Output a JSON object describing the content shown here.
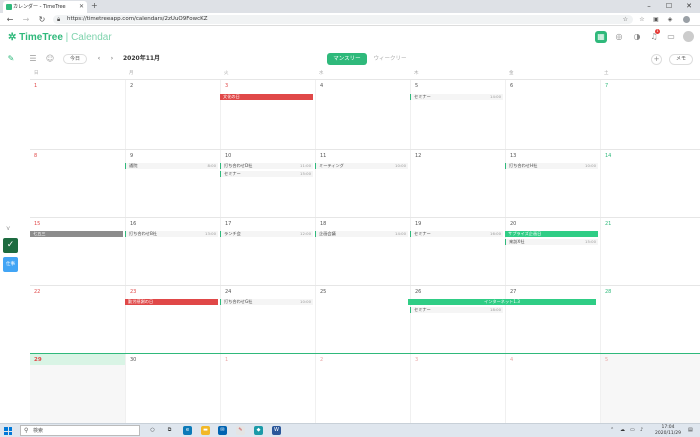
{
  "browser": {
    "tab_title": "カレンダー - TimeTree",
    "new_tab": "+",
    "url": "https://timetreeapp.com/calendars/2zUuO9FowcKZ",
    "win_min": "–",
    "win_max": "☐",
    "win_close": "✕"
  },
  "app": {
    "logo": "TimeTree",
    "logo_sub": "Calendar",
    "badge_count": "1"
  },
  "toolbar": {
    "today": "今日",
    "prev": "‹",
    "next": "›",
    "month": "2020年11月",
    "monthly": "マンスリー",
    "weekly": "ウィークリー",
    "add": "+",
    "memo": "メモ"
  },
  "rail": {
    "tag": "仕事"
  },
  "calendar": {
    "weekdays": [
      "日",
      "月",
      "火",
      "水",
      "木",
      "金",
      "土"
    ],
    "weeks": [
      {
        "days": [
          "1",
          "2",
          "3",
          "4",
          "5",
          "6",
          "7"
        ]
      },
      {
        "days": [
          "8",
          "9",
          "10",
          "11",
          "12",
          "13",
          "14"
        ]
      },
      {
        "days": [
          "15",
          "16",
          "17",
          "18",
          "19",
          "20",
          "21"
        ]
      },
      {
        "days": [
          "22",
          "23",
          "24",
          "25",
          "26",
          "27",
          "28"
        ]
      },
      {
        "days": [
          "29",
          "30",
          "1",
          "2",
          "3",
          "4",
          "5"
        ]
      }
    ],
    "events": {
      "bunka": "文化の日",
      "seminar1": "セミナー",
      "seminar1_time": "14:00",
      "tsujin": "通院",
      "tsujin_time": "8:00",
      "uchi_d": "打ち合わせD社",
      "uchi_d_time": "11:00",
      "meeting": "ミーティング",
      "meeting_time": "10:00",
      "uchi_h": "打ち合わせH社",
      "uchi_h_time": "10:00",
      "seminar2": "セミナー",
      "seminar2_time": "15:00",
      "shichigosan": "七五三",
      "uchi_b": "打ち合わせB社",
      "uchi_b_time": "13:00",
      "lunch": "ランチ会",
      "lunch_time": "12:00",
      "kikaku": "企画会議",
      "kikaku_time": "14:00",
      "seminar3": "セミナー",
      "seminar3_time": "16:00",
      "surprise": "サプライズ企画日",
      "raihou": "来訪X社",
      "raihou_time": "15:00",
      "kinrou": "勤労感謝の日",
      "uchi_g": "打ち合わせG社",
      "uchi_g_time": "10:00",
      "internet": "インターネット1.3",
      "seminar4": "セミナー",
      "seminar4_time": "18:00"
    }
  },
  "taskbar": {
    "search": "検索",
    "time": "17:04",
    "date": "2020/11/29"
  },
  "colors": {
    "brand": "#2fb97b",
    "holiday": "#e04848"
  }
}
